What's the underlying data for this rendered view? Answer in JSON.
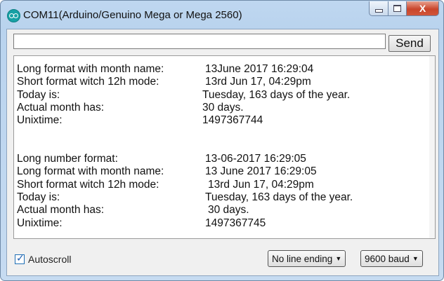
{
  "window": {
    "title": "COM11(Arduino/Genuino Mega or Mega 2560)",
    "minimize_glyph": "",
    "close_glyph": "X"
  },
  "toolbar": {
    "input_value": "",
    "send_label": "Send"
  },
  "output": {
    "lines": [
      {
        "label": "Long format with month name:",
        "value": "13June 2017 16:29:04"
      },
      {
        "label": "Short format witch 12h mode:",
        "value": "13rd Jun 17, 04:29pm"
      },
      {
        "label": "Today is:",
        "value": "Tuesday, 163 days of the year."
      },
      {
        "label": "Actual month has:",
        "value": "30 days."
      },
      {
        "label": "Unixtime:",
        "value": "1497367744"
      },
      {
        "label": "",
        "value": ""
      },
      {
        "label": "",
        "value": ""
      },
      {
        "label": "Long number format:",
        "value": "13-06-2017 16:29:05"
      },
      {
        "label": "Long format with month name:",
        "value": "13 June 2017 16:29:05"
      },
      {
        "label": "Short format witch 12h mode:",
        "value": "13rd Jun 17, 04:29pm"
      },
      {
        "label": "Today is:",
        "value": "Tuesday, 163 days of the year."
      },
      {
        "label": "Actual month has:",
        "value": "30 days."
      },
      {
        "label": "Unixtime:",
        "value": "1497367745"
      }
    ]
  },
  "footer": {
    "autoscroll_label": "Autoscroll",
    "autoscroll_checked": true,
    "line_ending": "No line ending",
    "baud": "9600 baud"
  },
  "icons": {
    "app": "arduino-icon",
    "minimize": "minimize-icon",
    "maximize": "maximize-icon",
    "close": "close-icon",
    "caret": "caret-down-icon"
  }
}
